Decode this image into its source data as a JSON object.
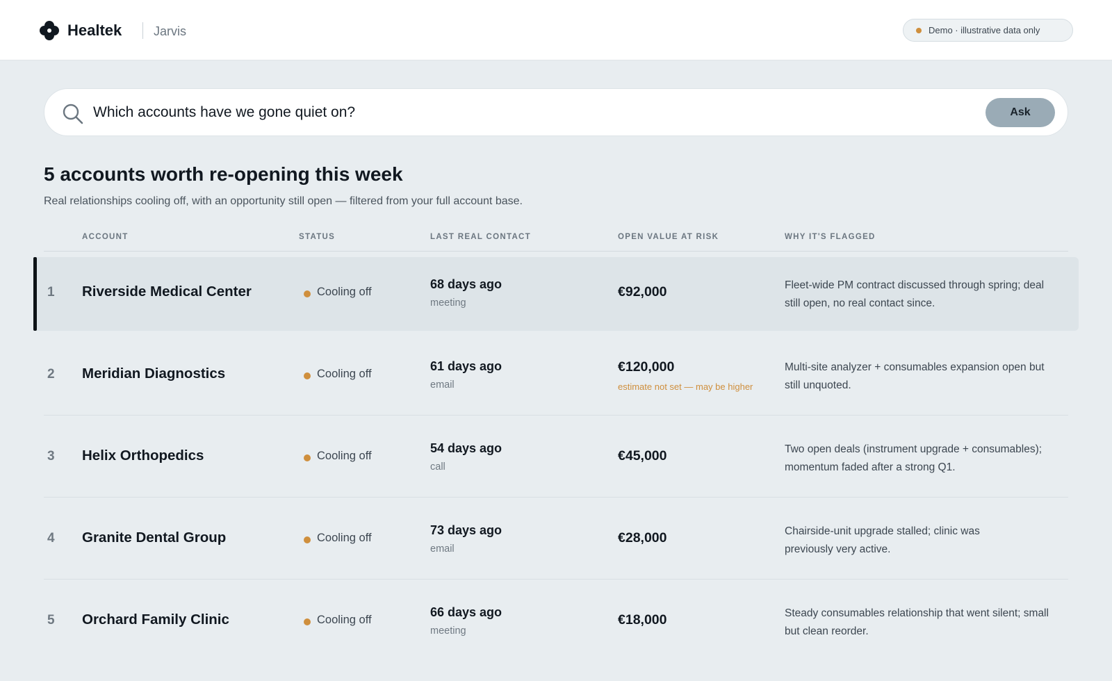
{
  "header": {
    "brand": "Healtek",
    "product": "Jarvis",
    "demo_badge": "Demo · illustrative data only"
  },
  "search": {
    "query": "Which accounts have we gone quiet on?",
    "ask_label": "Ask"
  },
  "results": {
    "title": "5 accounts worth re-opening this week",
    "subtitle": "Real relationships cooling off, with an opportunity still open — filtered from your full account base."
  },
  "table": {
    "columns": [
      "ACCOUNT",
      "STATUS",
      "LAST REAL CONTACT",
      "OPEN VALUE AT RISK",
      "WHY IT'S FLAGGED"
    ],
    "rows": [
      {
        "rank": "1",
        "account": "Riverside Medical Center",
        "status": "Cooling off",
        "last_contact": "68 days ago",
        "channel": "meeting",
        "value": "€92,000",
        "value_note": "",
        "reason": "Fleet-wide PM contract discussed through spring; deal still open, no real contact since."
      },
      {
        "rank": "2",
        "account": "Meridian Diagnostics",
        "status": "Cooling off",
        "last_contact": "61 days ago",
        "channel": "email",
        "value": "€120,000",
        "value_note": "estimate not set — may be higher",
        "reason": "Multi-site analyzer + consumables expansion open but still unquoted."
      },
      {
        "rank": "3",
        "account": "Helix Orthopedics",
        "status": "Cooling off",
        "last_contact": "54 days ago",
        "channel": "call",
        "value": "€45,000",
        "value_note": "",
        "reason": "Two open deals (instrument upgrade + consumables); momentum faded after a strong Q1."
      },
      {
        "rank": "4",
        "account": "Granite Dental Group",
        "status": "Cooling off",
        "last_contact": "73 days ago",
        "channel": "email",
        "value": "€28,000",
        "value_note": "",
        "reason": "Chairside-unit upgrade stalled; clinic was previously very active."
      },
      {
        "rank": "5",
        "account": "Orchard Family Clinic",
        "status": "Cooling off",
        "last_contact": "66 days ago",
        "channel": "meeting",
        "value": "€18,000",
        "value_note": "",
        "reason": "Steady consumables relationship that went silent; small but clean reorder."
      }
    ]
  },
  "colors": {
    "accent_amber": "#cf8f3d",
    "background": "#e8edf0",
    "ask_button": "#9aabb6"
  }
}
